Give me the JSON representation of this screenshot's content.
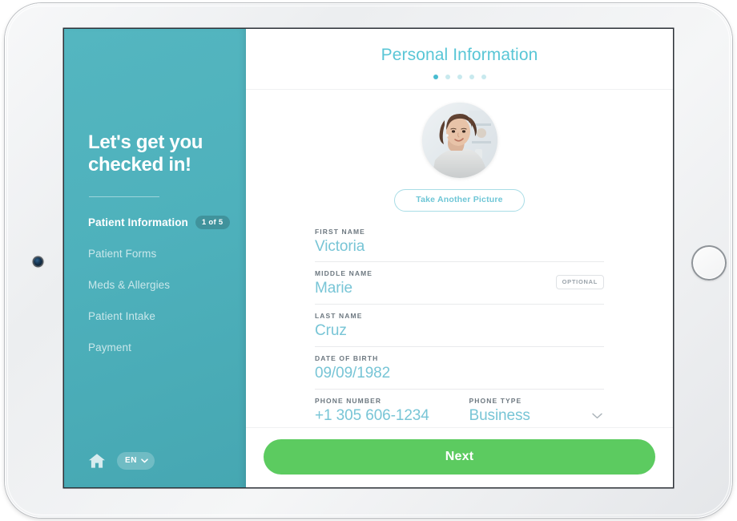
{
  "device": {
    "camera_name": "front-camera",
    "home_button_name": "device-home-button"
  },
  "sidebar": {
    "title": "Let's get you\ncheckedin!",
    "title_line1": "Let's get you",
    "title_line2": "checked in!",
    "nav_items": [
      {
        "label": "Patient Information",
        "badge": "1 of 5",
        "active": true
      },
      {
        "label": "Patient Forms",
        "badge": "",
        "active": false
      },
      {
        "label": "Meds & Allergies",
        "badge": "",
        "active": false
      },
      {
        "label": "Patient Intake",
        "badge": "",
        "active": false
      },
      {
        "label": "Payment",
        "badge": "",
        "active": false
      }
    ],
    "footer": {
      "home_icon": "home-icon",
      "language": "EN",
      "language_chevron": "chevron-down-icon"
    },
    "colors": {
      "bg_top": "#54b6c0",
      "bg_bottom": "#46a7b2",
      "badge_bg": "rgba(0,0,0,0.17)"
    }
  },
  "header": {
    "title": "Personal Information",
    "title_color": "#59c6d6",
    "step_dots": {
      "total": 5,
      "active_index": 0,
      "active_color": "#49bcd0",
      "inactive_color": "#c8e9ee"
    }
  },
  "avatar": {
    "name": "patient-photo",
    "take_picture_label": "Take Another Picture"
  },
  "form": {
    "fields": [
      {
        "name": "first-name",
        "label": "FIRST NAME",
        "value": "Victoria",
        "optional": false
      },
      {
        "name": "middle-name",
        "label": "MIDDLE NAME",
        "value": "Marie",
        "optional": true,
        "optional_badge": "OPTIONAL"
      },
      {
        "name": "last-name",
        "label": "LAST NAME",
        "value": "Cruz",
        "optional": false
      },
      {
        "name": "date-of-birth",
        "label": "DATE OF BIRTH",
        "value": "09/09/1982",
        "optional": false
      },
      {
        "name": "phone-number",
        "label": "PHONE NUMBER",
        "value": "+1 305 606-1234",
        "optional": false
      },
      {
        "name": "phone-type",
        "label": "PHONE TYPE",
        "value": "Business",
        "optional": false,
        "is_select": true
      }
    ],
    "value_color": "#78c5d6",
    "label_color": "#6d7880"
  },
  "footer": {
    "next_label": "Next",
    "next_color": "#5ccb60"
  }
}
